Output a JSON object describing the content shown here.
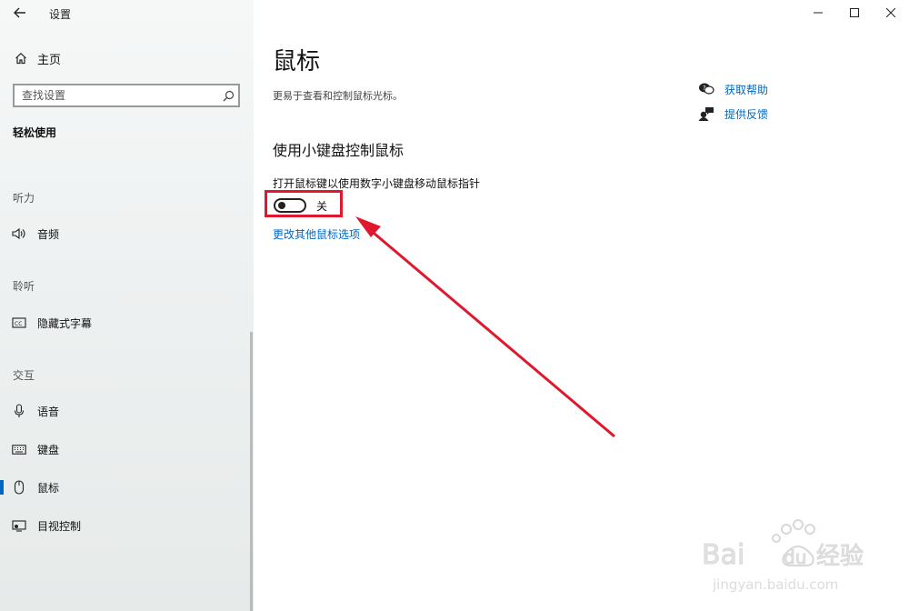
{
  "window": {
    "title": "设置",
    "controls": {
      "minimize": "—",
      "maximize": "☐",
      "close": "✕"
    }
  },
  "sidebar": {
    "home_label": "主页",
    "search_placeholder": "查找设置",
    "category": "轻松使用",
    "groups": [
      {
        "heading": "听力",
        "items": [
          {
            "label": "音频",
            "icon": "speaker-icon"
          }
        ]
      },
      {
        "heading": "聆听",
        "items": [
          {
            "label": "隐藏式字幕",
            "icon": "closed-caption-icon"
          }
        ]
      },
      {
        "heading": "交互",
        "items": [
          {
            "label": "语音",
            "icon": "microphone-icon"
          },
          {
            "label": "键盘",
            "icon": "keyboard-icon"
          },
          {
            "label": "鼠标",
            "icon": "mouse-icon",
            "selected": true
          },
          {
            "label": "目视控制",
            "icon": "eye-control-icon"
          }
        ]
      }
    ],
    "accent_color": "#0067c0"
  },
  "main": {
    "title": "鼠标",
    "description": "更易于查看和控制鼠标光标。",
    "help": {
      "get_help": "获取帮助",
      "give_feedback": "提供反馈"
    },
    "section_title": "使用小键盘控制鼠标",
    "setting_label": "打开鼠标键以使用数字小键盘移动鼠标指针",
    "toggle": {
      "state": "关",
      "on": false
    },
    "more_options_link": "更改其他鼠标选项"
  },
  "annotation": {
    "color": "#e0182d"
  },
  "watermark": {
    "brand": "Bai du 经验",
    "url": "jingyan.baidu.com"
  }
}
